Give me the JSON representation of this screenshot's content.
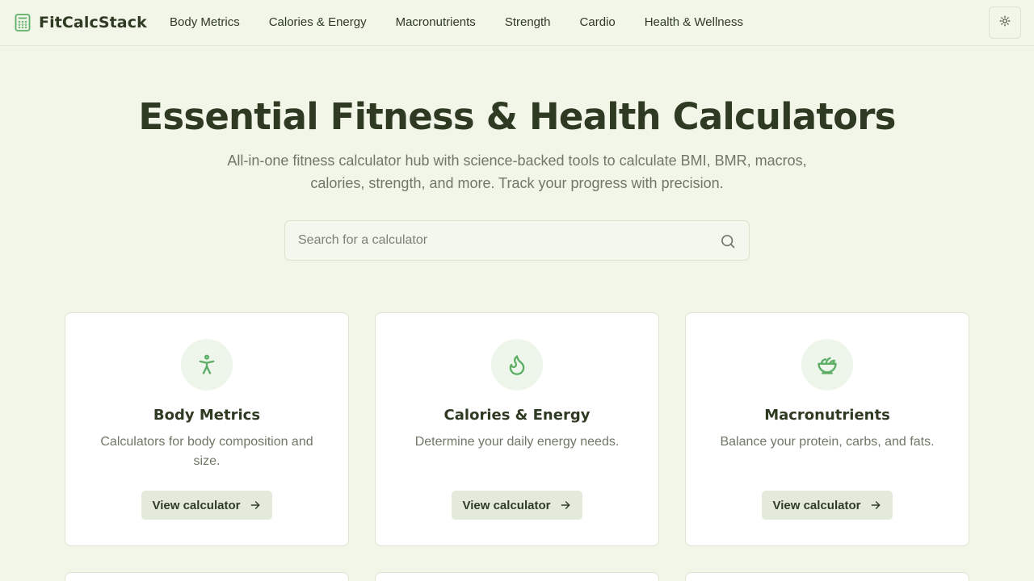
{
  "brand": {
    "name": "FitCalcStack",
    "icon": "calculator-icon"
  },
  "nav": {
    "items": [
      {
        "label": "Body Metrics"
      },
      {
        "label": "Calories & Energy"
      },
      {
        "label": "Macronutrients"
      },
      {
        "label": "Strength"
      },
      {
        "label": "Cardio"
      },
      {
        "label": "Health & Wellness"
      }
    ],
    "theme_icon": "sun-icon"
  },
  "hero": {
    "title": "Essential Fitness & Health Calculators",
    "subtitle": "All-in-one fitness calculator hub with science-backed tools to calculate BMI, BMR, macros, calories, strength, and more. Track your progress with precision."
  },
  "search": {
    "placeholder": "Search for a calculator",
    "value": "",
    "icon": "search-icon"
  },
  "cards": [
    {
      "title": "Body Metrics",
      "description": "Calculators for body composition and size.",
      "button": "View calculator",
      "icon": "accessibility-icon"
    },
    {
      "title": "Calories & Energy",
      "description": "Determine your daily energy needs.",
      "button": "View calculator",
      "icon": "flame-icon"
    },
    {
      "title": "Macronutrients",
      "description": "Balance your protein, carbs, and fats.",
      "button": "View calculator",
      "icon": "salad-icon"
    }
  ],
  "colors": {
    "background": "#f1f6e9",
    "text": "#2f3a23",
    "muted_text": "#6f7766",
    "accent_green": "#5cae64",
    "icon_circle": "#eef5ea",
    "button_bg": "#e4eadb",
    "card_border": "#dfe5d6"
  }
}
